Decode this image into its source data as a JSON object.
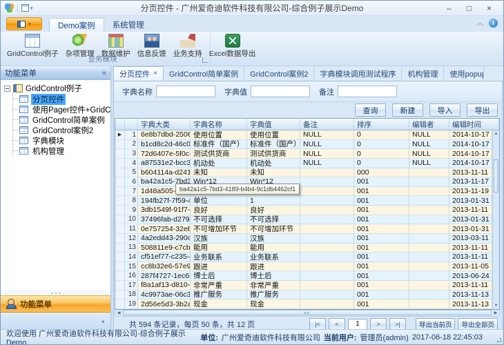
{
  "window": {
    "title": "分页控件 - 广州爱奇迪软件科技有限公司-综合例子展示Demo"
  },
  "icons": {
    "window-minimize": "–",
    "window-maximize": "□",
    "window-close": "×",
    "ribbon-collapse": "︿",
    "info": "i",
    "app-dropdown": "▾",
    "qat-dropdown": "▾",
    "sidebar-collapse": "«",
    "nav-dropdown": "▾",
    "tab-scroll-left": "◂",
    "tab-scroll-right": "▸",
    "tab-close": "×",
    "row-indicator": "▶",
    "scroll-up": "▲",
    "scroll-down": "▼",
    "scroll-left": "◀",
    "scroll-right": "▶"
  },
  "ribbon": {
    "tabs": [
      {
        "label": "Demo案例",
        "active": true
      },
      {
        "label": "系统管理",
        "active": false
      }
    ],
    "group": {
      "label": "业务模块"
    },
    "buttons": [
      {
        "label": "GridControl例子",
        "icon": "grid-table-icon",
        "css": "grid-table-big"
      },
      {
        "label": "杂项管理",
        "icon": "shapes-icon",
        "css": "shapes-icon"
      },
      {
        "label": "数据维护",
        "icon": "data-maintenance-icon",
        "css": "data-maint-icon"
      },
      {
        "label": "信息反馈",
        "icon": "feedback-photo-icon",
        "css": "feedback-icon"
      },
      {
        "label": "业务支持",
        "icon": "home-icon",
        "css": "home-icon"
      },
      {
        "label": "Excel数据导出",
        "icon": "excel-export-icon",
        "css": "excel-icon"
      }
    ]
  },
  "sidebar": {
    "title": "功能菜单",
    "tree": {
      "root": "GridControl例子",
      "items": [
        {
          "label": "分页控件",
          "selected": true
        },
        {
          "label": "使用Pager控件+GridControl的例",
          "selected": false
        },
        {
          "label": "GridControl简单案例",
          "selected": false
        },
        {
          "label": "GridControl案例2",
          "selected": false
        },
        {
          "label": "字典模块",
          "selected": false
        },
        {
          "label": "机构管理",
          "selected": false
        }
      ]
    },
    "footer_title": "功能菜单"
  },
  "doc_tabs": [
    {
      "label": "分页控件",
      "active": true
    },
    {
      "label": "GridControl简单案例",
      "active": false
    },
    {
      "label": "GridControl案例2",
      "active": false
    },
    {
      "label": "字典模块调用测试程序",
      "active": false
    },
    {
      "label": "机构管理",
      "active": false
    },
    {
      "label": "使用popupContainerEdit和popupContainer实现数据展示",
      "active": false
    }
  ],
  "filters": [
    {
      "label": "字典名称",
      "value": ""
    },
    {
      "label": "字典值",
      "value": ""
    },
    {
      "label": "备注",
      "value": ""
    }
  ],
  "actions": [
    "查询",
    "新建",
    "导入",
    "导出"
  ],
  "grid": {
    "columns": [
      "字典大类",
      "字典名称",
      "字典值",
      "备注",
      "排序",
      "编辑者",
      "编辑时间"
    ],
    "rows": [
      {
        "n": "1",
        "focused": true,
        "cells": [
          "6e8b7dbd-2506-4...",
          "使用位置",
          "使用位置",
          "NULL",
          "0",
          "NULL",
          "2014-10-17"
        ]
      },
      {
        "n": "2",
        "cells": [
          "b1cd8c2d-46c0-4...",
          "标准件（国产）",
          "标准件（国产）",
          "NULL",
          "0",
          "NULL",
          "2014-10-17"
        ]
      },
      {
        "n": "3",
        "cells": [
          "72d6407e-5f0c-4...",
          "测试供货商",
          "测试供货商",
          "NULL",
          "0",
          "NULL",
          "2014-10-17"
        ]
      },
      {
        "n": "4",
        "cells": [
          "a87531e2-bcc3-4...",
          "机动处",
          "机动处",
          "NULL",
          "0",
          "NULL",
          "2014-10-17"
        ]
      },
      {
        "n": "5",
        "cells": [
          "b604114a-d241-4...",
          "未知",
          "未知",
          "",
          "000",
          "",
          "2013-11-11"
        ]
      },
      {
        "n": "6",
        "cells": [
          "ba42a1c5-7bd3-4...",
          "Win*12",
          "Win*12",
          "",
          "001",
          "",
          "2013-11-17"
        ]
      },
      {
        "n": "7",
        "cells": [
          "1d48a505-4c35-",
          "",
          "",
          "",
          "001",
          "",
          "2013-11-19"
        ]
      },
      {
        "n": "8",
        "cells": [
          "194fb27f-7f59-4e...",
          "单位",
          "1",
          "",
          "001",
          "",
          "2013-01-31"
        ]
      },
      {
        "n": "9",
        "cells": [
          "3db1549f-91f7-4...",
          "良好",
          "良好",
          "",
          "001",
          "",
          "2013-11-11"
        ]
      },
      {
        "n": "10",
        "cells": [
          "37496fab-d279-4...",
          "不可选择",
          "不可选择",
          "",
          "001",
          "",
          "2013-01-31"
        ]
      },
      {
        "n": "11",
        "cells": [
          "0e757254-32eb-4...",
          "不可增加环节",
          "不可增加环节",
          "",
          "001",
          "",
          "2013-01-31"
        ]
      },
      {
        "n": "12",
        "cells": [
          "4a2edd43-290c-4...",
          "汉族",
          "汉族",
          "",
          "001",
          "",
          "2013-03-11"
        ]
      },
      {
        "n": "13",
        "cells": [
          "508811e9-c7cb-4...",
          "能用",
          "能用",
          "",
          "001",
          "",
          "2013-11-11"
        ]
      },
      {
        "n": "14",
        "cells": [
          "cf51ef77-c235-4e...",
          "业务联系",
          "业务联系",
          "",
          "001",
          "",
          "2013-11-11"
        ]
      },
      {
        "n": "15",
        "cells": [
          "cc8b32e6-57e9-4...",
          "跟进",
          "跟进",
          "",
          "001",
          "",
          "2013-11-05"
        ]
      },
      {
        "n": "16",
        "cells": [
          "287f4727-1ec6-4...",
          "博士后",
          "博士后",
          "",
          "001",
          "",
          "2013-06-24"
        ]
      },
      {
        "n": "17",
        "cells": [
          "f8a1af13-d810-48...",
          "非常严重",
          "非常严重",
          "",
          "001",
          "",
          "2013-11-11"
        ]
      },
      {
        "n": "18",
        "cells": [
          "4c9973ae-06c3-4...",
          "推广服务",
          "推广服务",
          "",
          "001",
          "",
          "2013-11-13"
        ]
      },
      {
        "n": "19",
        "cells": [
          "2d56e5d3-3b2a-4...",
          "现金",
          "现金",
          "",
          "001",
          "",
          "2013-11-13"
        ]
      }
    ],
    "tooltip": "ba42a1c5-7bd3-4189-b4b4-9c1db4462cf1"
  },
  "pager": {
    "summary": "共 594 条记录，每页 50 条，共 12 页",
    "first": "|<",
    "prev": "<",
    "page": "1",
    "next": ">",
    "last": ">|",
    "export_current": "导出当前页",
    "export_all": "导出全部页"
  },
  "statusbar": {
    "welcome": "欢迎使用 广州爱奇迪软件科技有限公司-综合例子展示Demo",
    "unit_label": "单位:",
    "unit": "广州爱奇迪软件科技有限公司",
    "user_label": "当前用户:",
    "user": "管理员(admin)",
    "time": "2017-06-18 22:45:03"
  },
  "colors": {
    "accent_orange": "#f8a62e",
    "selection_blue": "#4aa6f8",
    "panel_blue": "#d9e7f6",
    "row_odd": "#fbf5e2",
    "row_even": "#e4f3fd"
  }
}
